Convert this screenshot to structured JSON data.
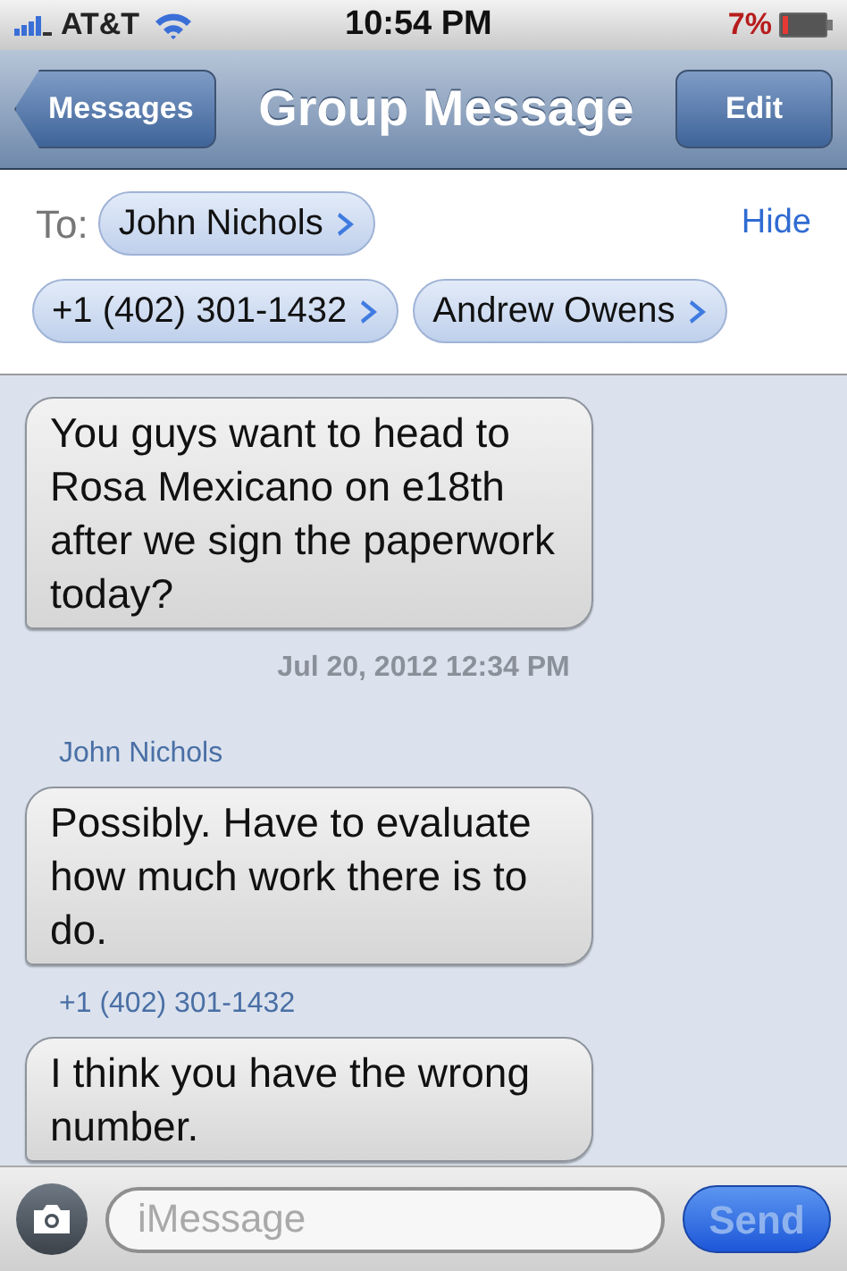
{
  "status_bar": {
    "carrier": "AT&T",
    "time": "10:54 PM",
    "battery": "7%"
  },
  "nav": {
    "back": "Messages",
    "title": "Group Message",
    "action": "Edit"
  },
  "recipients": {
    "label": "To:",
    "hide": "Hide",
    "chips": [
      "John Nichols",
      "+1 (402) 301-1432",
      "Andrew Owens"
    ]
  },
  "messages": [
    {
      "kind": "bubble",
      "text": "You guys want to head to Rosa Mexicano on e18th after we sign the paperwork today?"
    },
    {
      "kind": "timestamp",
      "text": "Jul 20, 2012 12:34 PM"
    },
    {
      "kind": "sender",
      "text": "John Nichols"
    },
    {
      "kind": "bubble",
      "text": "Possibly. Have to evaluate how much work there is to do."
    },
    {
      "kind": "sender",
      "text": "+1 (402) 301-1432"
    },
    {
      "kind": "bubble",
      "text": "I think you have the wrong number."
    }
  ],
  "composer": {
    "placeholder": "iMessage",
    "send": "Send",
    "send_disabled": true
  }
}
